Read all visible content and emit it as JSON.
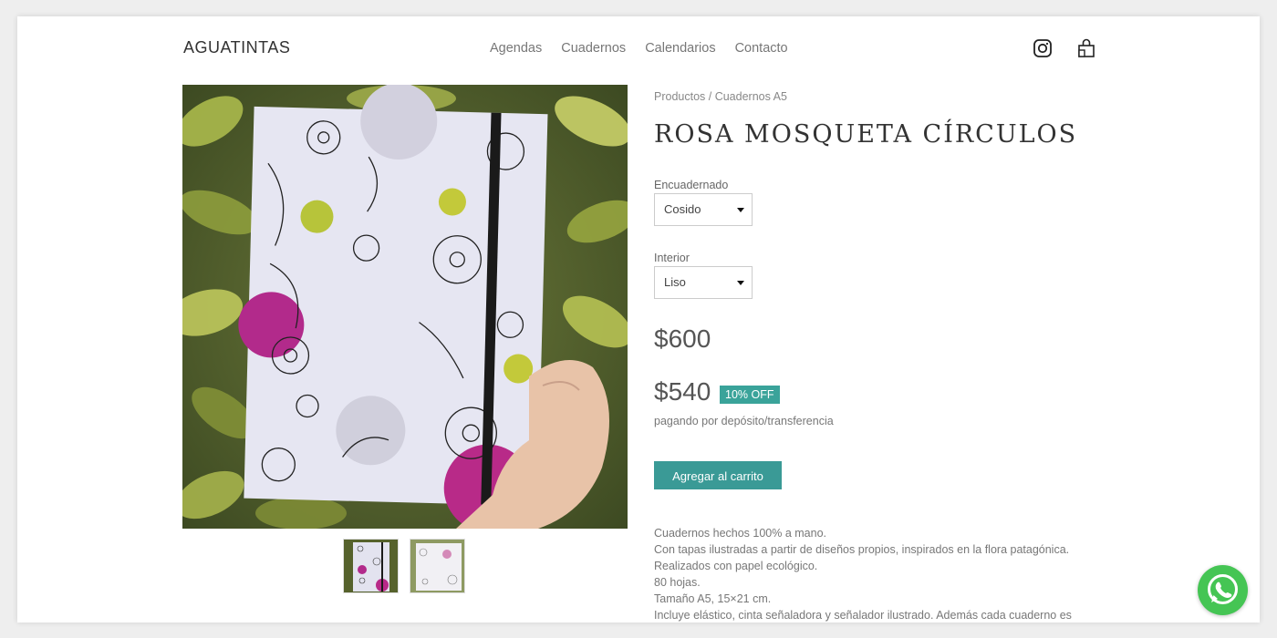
{
  "header": {
    "logo": "AGUATINTAS",
    "nav": [
      "Agendas",
      "Cuadernos",
      "Calendarios",
      "Contacto"
    ],
    "icons": [
      "instagram-icon",
      "shopping-bag-icon"
    ]
  },
  "gallery": {
    "thumbnail_count": 2
  },
  "product": {
    "breadcrumb": "Productos / Cuadernos A5",
    "title": "ROSA MOSQUETA CÍRCULOS",
    "options": [
      {
        "label": "Encuadernado",
        "selected": "Cosido"
      },
      {
        "label": "Interior",
        "selected": "Liso"
      }
    ],
    "price_original": "$600",
    "price_discounted": "$540",
    "discount_badge": "10% OFF",
    "payment_note": "pagando por depósito/transferencia",
    "add_to_cart_label": "Agregar al carrito",
    "description": [
      "Cuadernos hechos 100% a mano.",
      "Con tapas ilustradas a partir de diseños propios, inspirados en la flora patagónica.",
      "Realizados con papel ecológico.",
      "80 hojas.",
      "Tamaño A5, 15×21 cm.",
      "Incluye elástico, cinta señaladora y señalador ilustrado. Además cada cuaderno es"
    ]
  },
  "colors": {
    "accent": "#3a9a96",
    "badge": "#3aa39a",
    "whatsapp": "#45c554"
  },
  "floating": {
    "icon": "whatsapp-icon"
  }
}
